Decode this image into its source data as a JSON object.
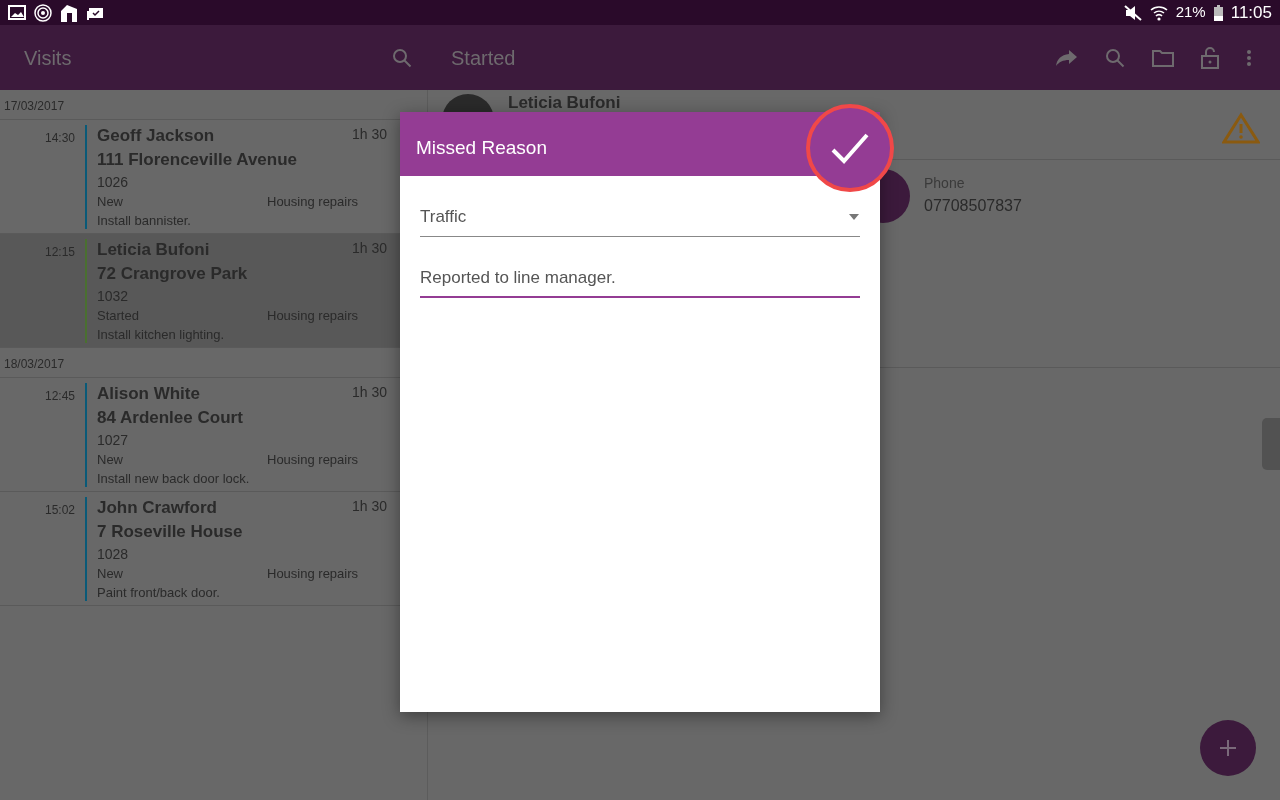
{
  "status_bar": {
    "battery": "21%",
    "time": "11:05"
  },
  "visits_toolbar": {
    "title": "Visits"
  },
  "detail_toolbar": {
    "title": "Started"
  },
  "visit_groups": [
    {
      "date": "17/03/2017",
      "visits": [
        {
          "time": "14:30",
          "name": "Geoff Jackson",
          "duration": "1h 30",
          "address": "111 Florenceville Avenue",
          "number": "1026",
          "status": "New",
          "category": "Housing repairs",
          "description": "Install bannister.",
          "color": "#0a5a78",
          "selected": false
        },
        {
          "time": "12:15",
          "name": "Leticia Bufoni",
          "duration": "1h 30",
          "address": "72 Crangrove Park",
          "number": "1032",
          "status": "Started",
          "category": "Housing repairs",
          "description": "Install kitchen lighting.",
          "color": "#4a7030",
          "selected": true
        }
      ]
    },
    {
      "date": "18/03/2017",
      "visits": [
        {
          "time": "12:45",
          "name": "Alison White",
          "duration": "1h 30",
          "address": "84 Ardenlee Court",
          "number": "1027",
          "status": "New",
          "category": "Housing repairs",
          "description": "Install new back door lock.",
          "color": "#0a5a78",
          "selected": false
        },
        {
          "time": "15:02",
          "name": "John Crawford",
          "duration": "1h 30",
          "address": "7 Roseville House",
          "number": "1028",
          "status": "New",
          "category": "Housing repairs",
          "description": "Paint front/back door.",
          "color": "#0a5a78",
          "selected": false
        }
      ]
    }
  ],
  "detail": {
    "contact_name": "Leticia Bufoni",
    "phone_label": "Phone",
    "phone": "07708507837"
  },
  "dialog": {
    "title": "Missed Reason",
    "reason": "Traffic",
    "note": "Reported to line manager.",
    "note_focused": true
  }
}
